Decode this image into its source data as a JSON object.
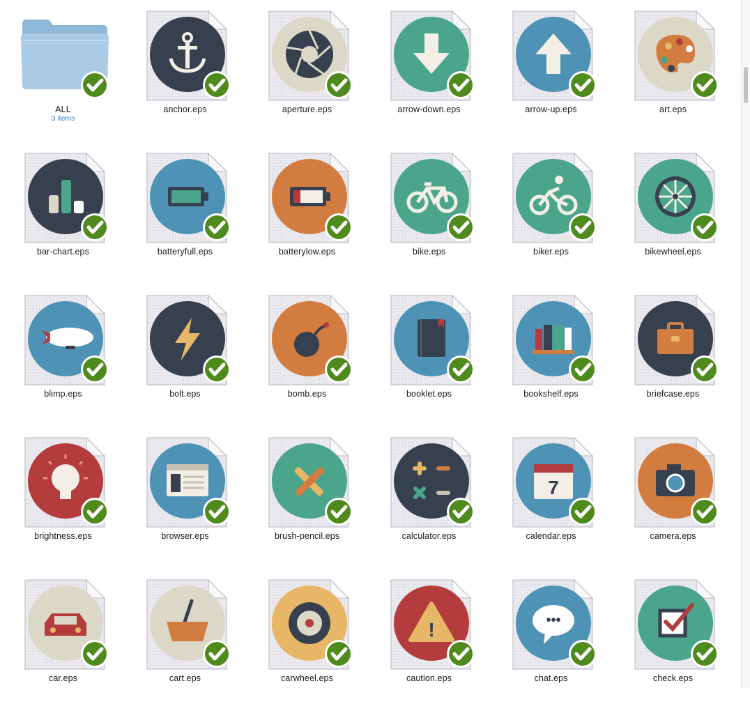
{
  "window": {
    "title": ""
  },
  "folder": {
    "name": "ALL",
    "count": "3 items",
    "icon": "folder-icon"
  },
  "colors": {
    "navy": "#36404e",
    "blue": "#4e93b6",
    "teal": "#4aa58b",
    "orange": "#d27c40",
    "red": "#b43c3c",
    "beige": "#dcd8c8",
    "yellow": "#e7b767",
    "check": "#4f8a1c"
  },
  "files": [
    {
      "name": "anchor.eps",
      "icon": "anchor-icon",
      "bg": "navy"
    },
    {
      "name": "aperture.eps",
      "icon": "aperture-icon",
      "bg": "beige"
    },
    {
      "name": "arrow-down.eps",
      "icon": "arrow-down-icon",
      "bg": "teal"
    },
    {
      "name": "arrow-up.eps",
      "icon": "arrow-up-icon",
      "bg": "blue"
    },
    {
      "name": "art.eps",
      "icon": "palette-icon",
      "bg": "beige"
    },
    {
      "name": "bar-chart.eps",
      "icon": "bar-chart-icon",
      "bg": "navy"
    },
    {
      "name": "batteryfull.eps",
      "icon": "battery-full-icon",
      "bg": "blue"
    },
    {
      "name": "batterylow.eps",
      "icon": "battery-low-icon",
      "bg": "orange"
    },
    {
      "name": "bike.eps",
      "icon": "bike-icon",
      "bg": "teal"
    },
    {
      "name": "biker.eps",
      "icon": "biker-icon",
      "bg": "teal"
    },
    {
      "name": "bikewheel.eps",
      "icon": "bikewheel-icon",
      "bg": "teal"
    },
    {
      "name": "blimp.eps",
      "icon": "blimp-icon",
      "bg": "blue"
    },
    {
      "name": "bolt.eps",
      "icon": "bolt-icon",
      "bg": "navy"
    },
    {
      "name": "bomb.eps",
      "icon": "bomb-icon",
      "bg": "orange"
    },
    {
      "name": "booklet.eps",
      "icon": "booklet-icon",
      "bg": "blue"
    },
    {
      "name": "bookshelf.eps",
      "icon": "bookshelf-icon",
      "bg": "blue"
    },
    {
      "name": "briefcase.eps",
      "icon": "briefcase-icon",
      "bg": "navy"
    },
    {
      "name": "brightness.eps",
      "icon": "lightbulb-icon",
      "bg": "red"
    },
    {
      "name": "browser.eps",
      "icon": "browser-icon",
      "bg": "blue"
    },
    {
      "name": "brush-pencil.eps",
      "icon": "brush-pencil-icon",
      "bg": "teal"
    },
    {
      "name": "calculator.eps",
      "icon": "calculator-icon",
      "bg": "navy"
    },
    {
      "name": "calendar.eps",
      "icon": "calendar-icon",
      "bg": "blue",
      "text": "7"
    },
    {
      "name": "camera.eps",
      "icon": "camera-icon",
      "bg": "orange"
    },
    {
      "name": "car.eps",
      "icon": "car-icon",
      "bg": "beige"
    },
    {
      "name": "cart.eps",
      "icon": "basket-icon",
      "bg": "beige"
    },
    {
      "name": "carwheel.eps",
      "icon": "carwheel-icon",
      "bg": "yellow"
    },
    {
      "name": "caution.eps",
      "icon": "caution-icon",
      "bg": "red",
      "text": "!"
    },
    {
      "name": "chat.eps",
      "icon": "chat-icon",
      "bg": "blue",
      "text": "•••"
    },
    {
      "name": "check.eps",
      "icon": "checkbox-icon",
      "bg": "teal"
    }
  ]
}
